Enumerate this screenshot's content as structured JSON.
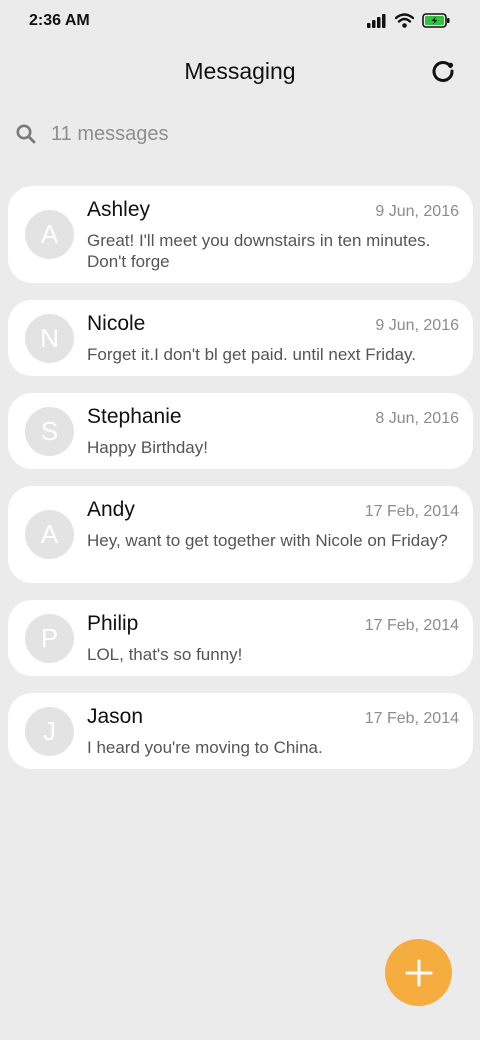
{
  "status_bar": {
    "time": "2:36 AM"
  },
  "header": {
    "title": "Messaging"
  },
  "search": {
    "placeholder": "11 messages"
  },
  "conversations": [
    {
      "initial": "A",
      "name": "Ashley",
      "date": "9 Jun, 2016",
      "preview": "Great! I'll meet you downstairs in ten minutes. Don't forge"
    },
    {
      "initial": "N",
      "name": "Nicole",
      "date": "9 Jun, 2016",
      "preview": "Forget it.I don't bl get paid. until next Friday."
    },
    {
      "initial": "S",
      "name": "Stephanie",
      "date": "8 Jun, 2016",
      "preview": "Happy Birthday!"
    },
    {
      "initial": "A",
      "name": "Andy",
      "date": "17 Feb, 2014",
      "preview": "Hey, want to get together with Nicole on Friday?"
    },
    {
      "initial": "P",
      "name": "Philip",
      "date": "17 Feb, 2014",
      "preview": "LOL, that's so funny!"
    },
    {
      "initial": "J",
      "name": "Jason",
      "date": "17 Feb, 2014",
      "preview": "I heard you're moving to China."
    }
  ],
  "colors": {
    "background": "#ebebeb",
    "card": "#ffffff",
    "avatar": "#e3e3e3",
    "fab": "#f6ad3f",
    "battery": "#2ec43c"
  },
  "icons": {
    "signal": "cellular-signal-icon",
    "wifi": "wifi-icon",
    "battery": "battery-charging-icon",
    "refresh": "refresh-icon",
    "search": "search-icon",
    "compose": "plus-icon"
  }
}
